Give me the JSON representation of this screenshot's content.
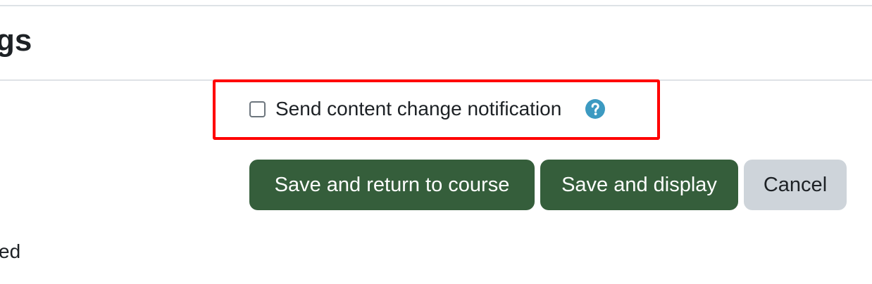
{
  "header": {
    "title_fragment": "gs"
  },
  "notification": {
    "checkbox_label": "Send content change notification",
    "checked": false,
    "help_icon": "question-circle-icon",
    "help_icon_color": "#3c9ac1"
  },
  "actions": {
    "save_return_label": "Save and return to course",
    "save_display_label": "Save and display",
    "cancel_label": "Cancel"
  },
  "footer": {
    "partial_text": "ed"
  },
  "colors": {
    "primary_button": "#355e3b",
    "secondary_button": "#ced4da",
    "highlight_border": "#ff0000"
  }
}
